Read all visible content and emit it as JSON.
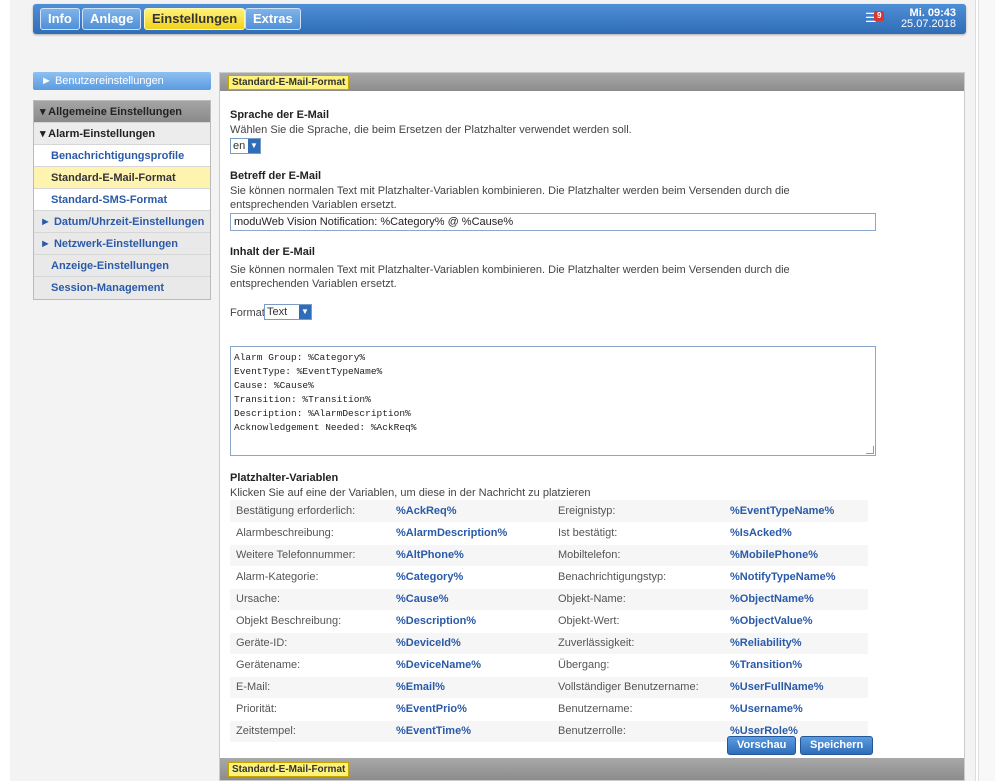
{
  "nav": {
    "tabs": [
      {
        "label": "Info"
      },
      {
        "label": "Anlage"
      },
      {
        "label": "Einstellungen"
      },
      {
        "label": "Extras"
      }
    ],
    "alarm_count": "9",
    "time": "Mi. 09:43",
    "date": "25.07.2018"
  },
  "sidebar": {
    "user_settings": "► Benutzereinstellungen",
    "general": "▾ Allgemeine Einstellungen",
    "alarm": "▾ Alarm-Einstellungen",
    "notification_profiles": "Benachrichtigungsprofile",
    "email_format": "Standard-E-Mail-Format",
    "sms_format": "Standard-SMS-Format",
    "datetime": "► Datum/Uhrzeit-Einstellungen",
    "network": "► Netzwerk-Einstellungen",
    "display": "Anzeige-Einstellungen",
    "session": "Session-Management"
  },
  "panel": {
    "title": "Standard-E-Mail-Format",
    "footer_title": "Standard-E-Mail-Format",
    "language": {
      "title": "Sprache der E-Mail",
      "desc": "Wählen Sie die Sprache, die beim Ersetzen der Platzhalter verwendet werden soll.",
      "value": "en"
    },
    "subject": {
      "title": "Betreff der E-Mail",
      "desc": "Sie können normalen Text mit Platzhalter-Variablen kombinieren. Die Platzhalter werden beim Versenden durch die entsprechenden Variablen ersetzt.",
      "value": "moduWeb Vision Notification: %Category% @ %Cause%"
    },
    "body": {
      "title": "Inhalt der E-Mail",
      "desc": "Sie können normalen Text mit Platzhalter-Variablen kombinieren. Die Platzhalter werden beim Versenden durch die entsprechenden Variablen ersetzt.",
      "format_label": "Format:",
      "format_value": "Text",
      "lines": [
        "Alarm Group: %Category%",
        "EventType: %EventTypeName%",
        "Cause: %Cause%",
        "Transition: %Transition%",
        "Description: %AlarmDescription%",
        "Acknowledgement Needed: %AckReq%"
      ]
    },
    "placeholders": {
      "title": "Platzhalter-Variablen",
      "desc": "Klicken Sie auf eine der Variablen, um diese in der Nachricht zu platzieren",
      "rows": [
        [
          "Bestätigung erforderlich:",
          "%AckReq%",
          "Ereignistyp:",
          "%EventTypeName%"
        ],
        [
          "Alarmbeschreibung:",
          "%AlarmDescription%",
          "Ist bestätigt:",
          "%IsAcked%"
        ],
        [
          "Weitere Telefonnummer:",
          "%AltPhone%",
          "Mobiltelefon:",
          "%MobilePhone%"
        ],
        [
          "Alarm-Kategorie:",
          "%Category%",
          "Benachrichtigungstyp:",
          "%NotifyTypeName%"
        ],
        [
          "Ursache:",
          "%Cause%",
          "Objekt-Name:",
          "%ObjectName%"
        ],
        [
          "Objekt Beschreibung:",
          "%Description%",
          "Objekt-Wert:",
          "%ObjectValue%"
        ],
        [
          "Geräte-ID:",
          "%DeviceId%",
          "Zuverlässigkeit:",
          "%Reliability%"
        ],
        [
          "Gerätename:",
          "%DeviceName%",
          "Übergang:",
          "%Transition%"
        ],
        [
          "E-Mail:",
          "%Email%",
          "Vollständiger Benutzername:",
          "%UserFullName%"
        ],
        [
          "Priorität:",
          "%EventPrio%",
          "Benutzername:",
          "%Username%"
        ],
        [
          "Zeitstempel:",
          "%EventTime%",
          "Benutzerrolle:",
          "%UserRole%"
        ]
      ]
    },
    "preview_label": "Vorschau",
    "save_label": "Speichern"
  }
}
